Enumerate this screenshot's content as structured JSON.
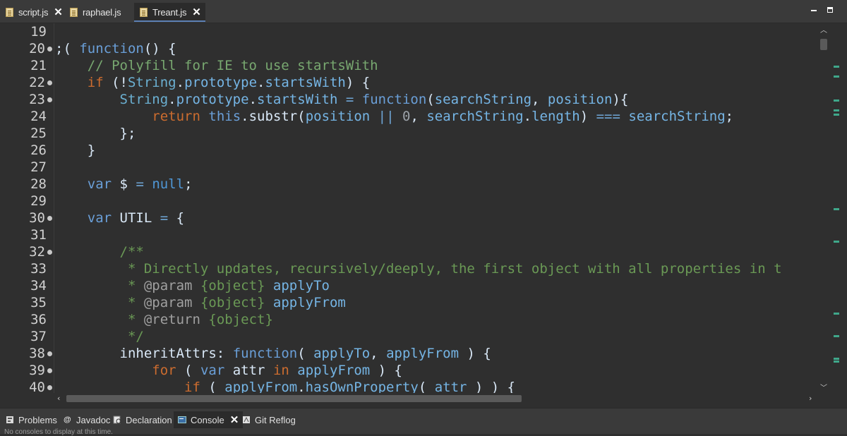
{
  "editor_tabs": [
    {
      "label": "script.js",
      "closable": true,
      "active": false
    },
    {
      "label": "raphael.js",
      "closable": false,
      "active": false
    },
    {
      "label": "Treant.js",
      "closable": true,
      "active": true
    }
  ],
  "line_numbers": [
    "19",
    "20",
    "21",
    "22",
    "23",
    "24",
    "25",
    "26",
    "27",
    "28",
    "29",
    "30",
    "31",
    "32",
    "33",
    "34",
    "35",
    "36",
    "37",
    "38",
    "39",
    "40"
  ],
  "folded_lines": [
    "20",
    "22",
    "23",
    "30",
    "32",
    "38",
    "39",
    "40"
  ],
  "code": {
    "l19": "",
    "l20": ";( function() {",
    "l21": "    // Polyfill for IE to use startsWith",
    "l22": "    if (!String.prototype.startsWith) {",
    "l23": "        String.prototype.startsWith = function(searchString, position){",
    "l24": "            return this.substr(position || 0, searchString.length) === searchString;",
    "l25": "        };",
    "l26": "    }",
    "l27": "",
    "l28": "    var $ = null;",
    "l29": "",
    "l30": "    var UTIL = {",
    "l31": "",
    "l32": "        /**",
    "l33": "         * Directly updates, recursively/deeply, the first object with all properties in t",
    "l34": "         * @param {object} applyTo",
    "l35": "         * @param {object} applyFrom",
    "l36": "         * @return {object}",
    "l37": "         */",
    "l38": "        inheritAttrs: function( applyTo, applyFrom ) {",
    "l39": "            for ( var attr in applyFrom ) {",
    "l40": "                if ( applyFrom.hasOwnProperty( attr ) ) {"
  },
  "view_tabs": [
    {
      "label": "Problems",
      "icon": "problems-icon"
    },
    {
      "label": "Javadoc",
      "icon": "javadoc-icon"
    },
    {
      "label": "Declaration",
      "icon": "declaration-icon"
    },
    {
      "label": "Console",
      "icon": "console-icon",
      "active": true
    },
    {
      "label": "Git Reflog",
      "icon": "git-reflog-icon"
    }
  ],
  "status_text": "No consoles to display at this time.",
  "colors": {
    "background": "#2f2f2f",
    "keyword": "#cc6c2f",
    "comment": "#78a870",
    "property": "#75b5e5"
  }
}
